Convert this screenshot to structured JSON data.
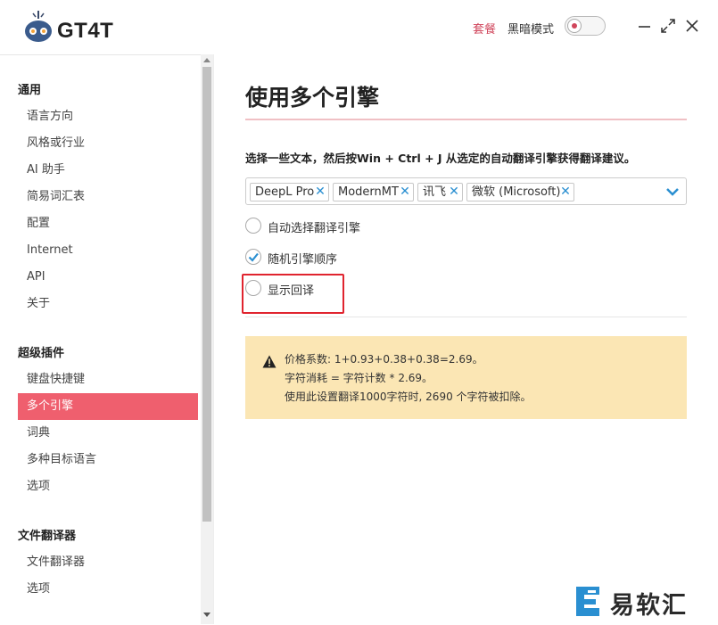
{
  "app": {
    "name": "GT4T"
  },
  "header": {
    "plan_link": "套餐",
    "dark_mode_label": "黑暗模式",
    "dark_mode_on": false
  },
  "sidebar": {
    "sections": [
      {
        "title": "通用",
        "items": [
          "语言方向",
          "风格或行业",
          "AI 助手",
          "简易词汇表",
          "配置",
          "Internet",
          "API",
          "关于"
        ]
      },
      {
        "title": "超级插件",
        "items": [
          "键盘快捷键",
          "多个引擎",
          "词典",
          "多种目标语言",
          "选项"
        ]
      },
      {
        "title": "文件翻译器",
        "items": [
          "文件翻译器",
          "选项"
        ]
      }
    ],
    "active_item": "多个引擎"
  },
  "main": {
    "title": "使用多个引擎",
    "description": "选择一些文本，然后按Win + Ctrl + J 从选定的自动翻译引擎获得翻译建议。",
    "engines": [
      "DeepL Pro",
      "ModernMT",
      "讯飞",
      "微软 (Microsoft)"
    ],
    "options": [
      {
        "label": "自动选择翻译引擎",
        "checked": false
      },
      {
        "label": "随机引擎顺序",
        "checked": true
      },
      {
        "label": "显示回译",
        "checked": false
      }
    ],
    "notice": {
      "line1": "价格系数:  1+0.93+0.38+0.38=2.69。",
      "line2": "字符消耗 = 字符计数 * 2.69。",
      "line3": "使用此设置翻译1000字符时,  2690 个字符被扣除。"
    }
  },
  "watermark": {
    "text": "易软汇"
  },
  "colors": {
    "accent": "#ef5f6e",
    "link": "#d0455b",
    "notice_bg": "#fbe6b4",
    "tag_x": "#2a8fd1",
    "highlight": "#e0242f"
  }
}
